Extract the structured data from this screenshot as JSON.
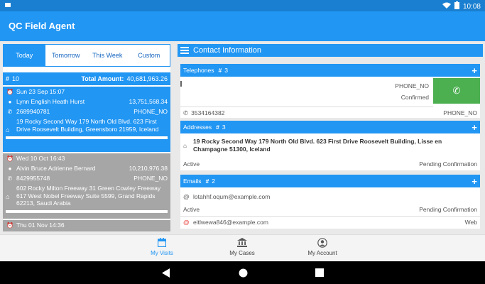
{
  "status": {
    "time": "10:08",
    "battery_icon": "battery-icon",
    "wifi_icon": "wifi-icon"
  },
  "app": {
    "title": "QC Field Agent"
  },
  "tabs": [
    {
      "label": "Today",
      "active": true
    },
    {
      "label": "Tomorrow",
      "active": false
    },
    {
      "label": "This Week",
      "active": false
    },
    {
      "label": "Custom",
      "active": false
    }
  ],
  "summary": {
    "hash": "#",
    "count": "10",
    "total_label": "Total Amount:",
    "total_value": "40,681,963.26"
  },
  "visits": [
    {
      "date": "Sun 23 Sep 15:07",
      "name": "Lynn English Heath Hurst",
      "amount": "13,751,568.34",
      "phone": "2689940781",
      "phone_label": "PHONE_NO",
      "address": "19 Rocky Second Way 179 North Old Blvd. 623 First Drive Roosevelt Building, Greensboro 21959, Iceland"
    },
    {
      "date": "Wed 10 Oct 16:43",
      "name": "Alvin Bruce Adrienne Bernard",
      "amount": "10,210,976.38",
      "phone": "8429955748",
      "phone_label": "PHONE_NO",
      "address": "602 Rocky Milton Freeway 31 Green Cowley Freeway 617 West Nobel Freeway Suite 5599, Grand Rapids 62213, Saudi Arabia"
    },
    {
      "date": "Thu 01 Nov 14:36"
    }
  ],
  "contact": {
    "header": "Contact Information",
    "telephones": {
      "title": "Telephones",
      "hash": "#",
      "count": "3",
      "items": [
        {
          "type": "PHONE_NO",
          "status": "Confirmed"
        },
        {
          "number": "3534164382",
          "type": "PHONE_NO"
        }
      ]
    },
    "addresses": {
      "title": "Addresses",
      "hash": "#",
      "count": "3",
      "items": [
        {
          "text": "19 Rocky Second Way 179 North Old Blvd. 623 First Drive Roosevelt Building, Lisse en Champagne 51300, Iceland",
          "state": "Active",
          "status": "Pending Confirmation"
        }
      ]
    },
    "emails": {
      "title": "Emails",
      "hash": "#",
      "count": "2",
      "items": [
        {
          "address": "lotahhf.oqum@example.com",
          "state": "Active",
          "status": "Pending Confirmation"
        },
        {
          "address": "eitlwewa846@example.com",
          "status": "Web"
        }
      ]
    }
  },
  "bottom_nav": [
    {
      "label": "My Visits",
      "icon": "calendar-icon",
      "active": true
    },
    {
      "label": "My Cases",
      "icon": "bank-icon",
      "active": false
    },
    {
      "label": "My Account",
      "icon": "account-icon",
      "active": false
    }
  ],
  "colors": {
    "primary": "#2196f3",
    "status_bar": "#1a7fd0",
    "call": "#4caf50",
    "inactive_card": "#a6a6a6"
  }
}
